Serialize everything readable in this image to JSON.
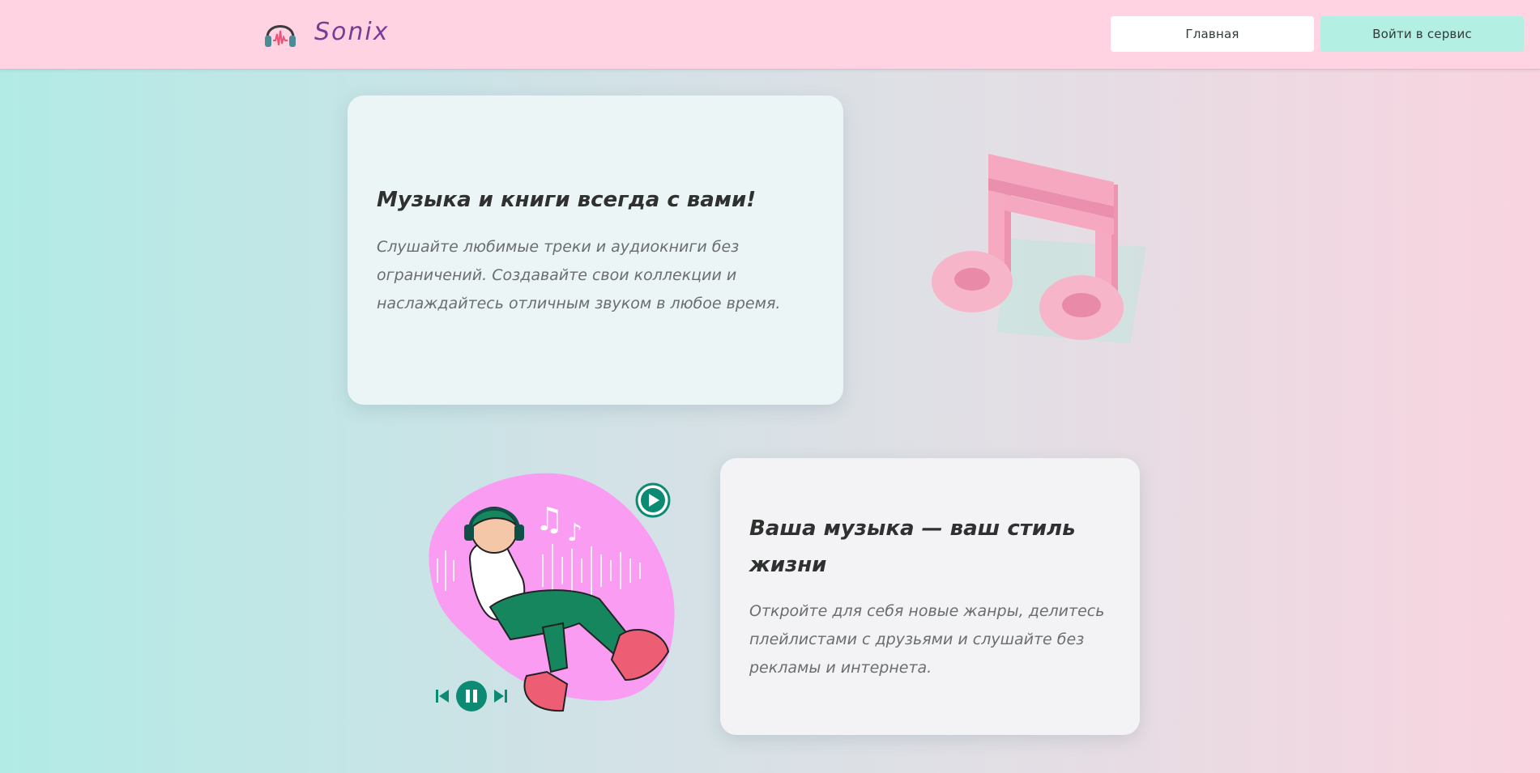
{
  "header": {
    "logo_icon": "headphones-logo-icon",
    "brand": "Sonix",
    "nav": {
      "home_label": "Главная",
      "login_label": "Войти в сервис"
    }
  },
  "hero": {
    "title": "Музыка и книги всегда с вами!",
    "text": "Слушайте любимые треки и аудиокниги без ограничений. Создавайте свои коллекции и наслаждайтесь отличным звуком в любое время.",
    "illustration": "music-note-illustration"
  },
  "feature": {
    "title": "Ваша музыка — ваш стиль жизни",
    "text": "Откройте для себя новые жанры, делитесь плейлистами с друзьями и слушайте без рекламы и интернета.",
    "illustration": "girl-with-headphones-illustration"
  },
  "colors": {
    "header_bg": "#ffd3e1",
    "brand": "#7a3c93",
    "login_button": "#b4efe3",
    "accent_pink": "#f6a3be",
    "player_teal": "#0d8a74"
  }
}
